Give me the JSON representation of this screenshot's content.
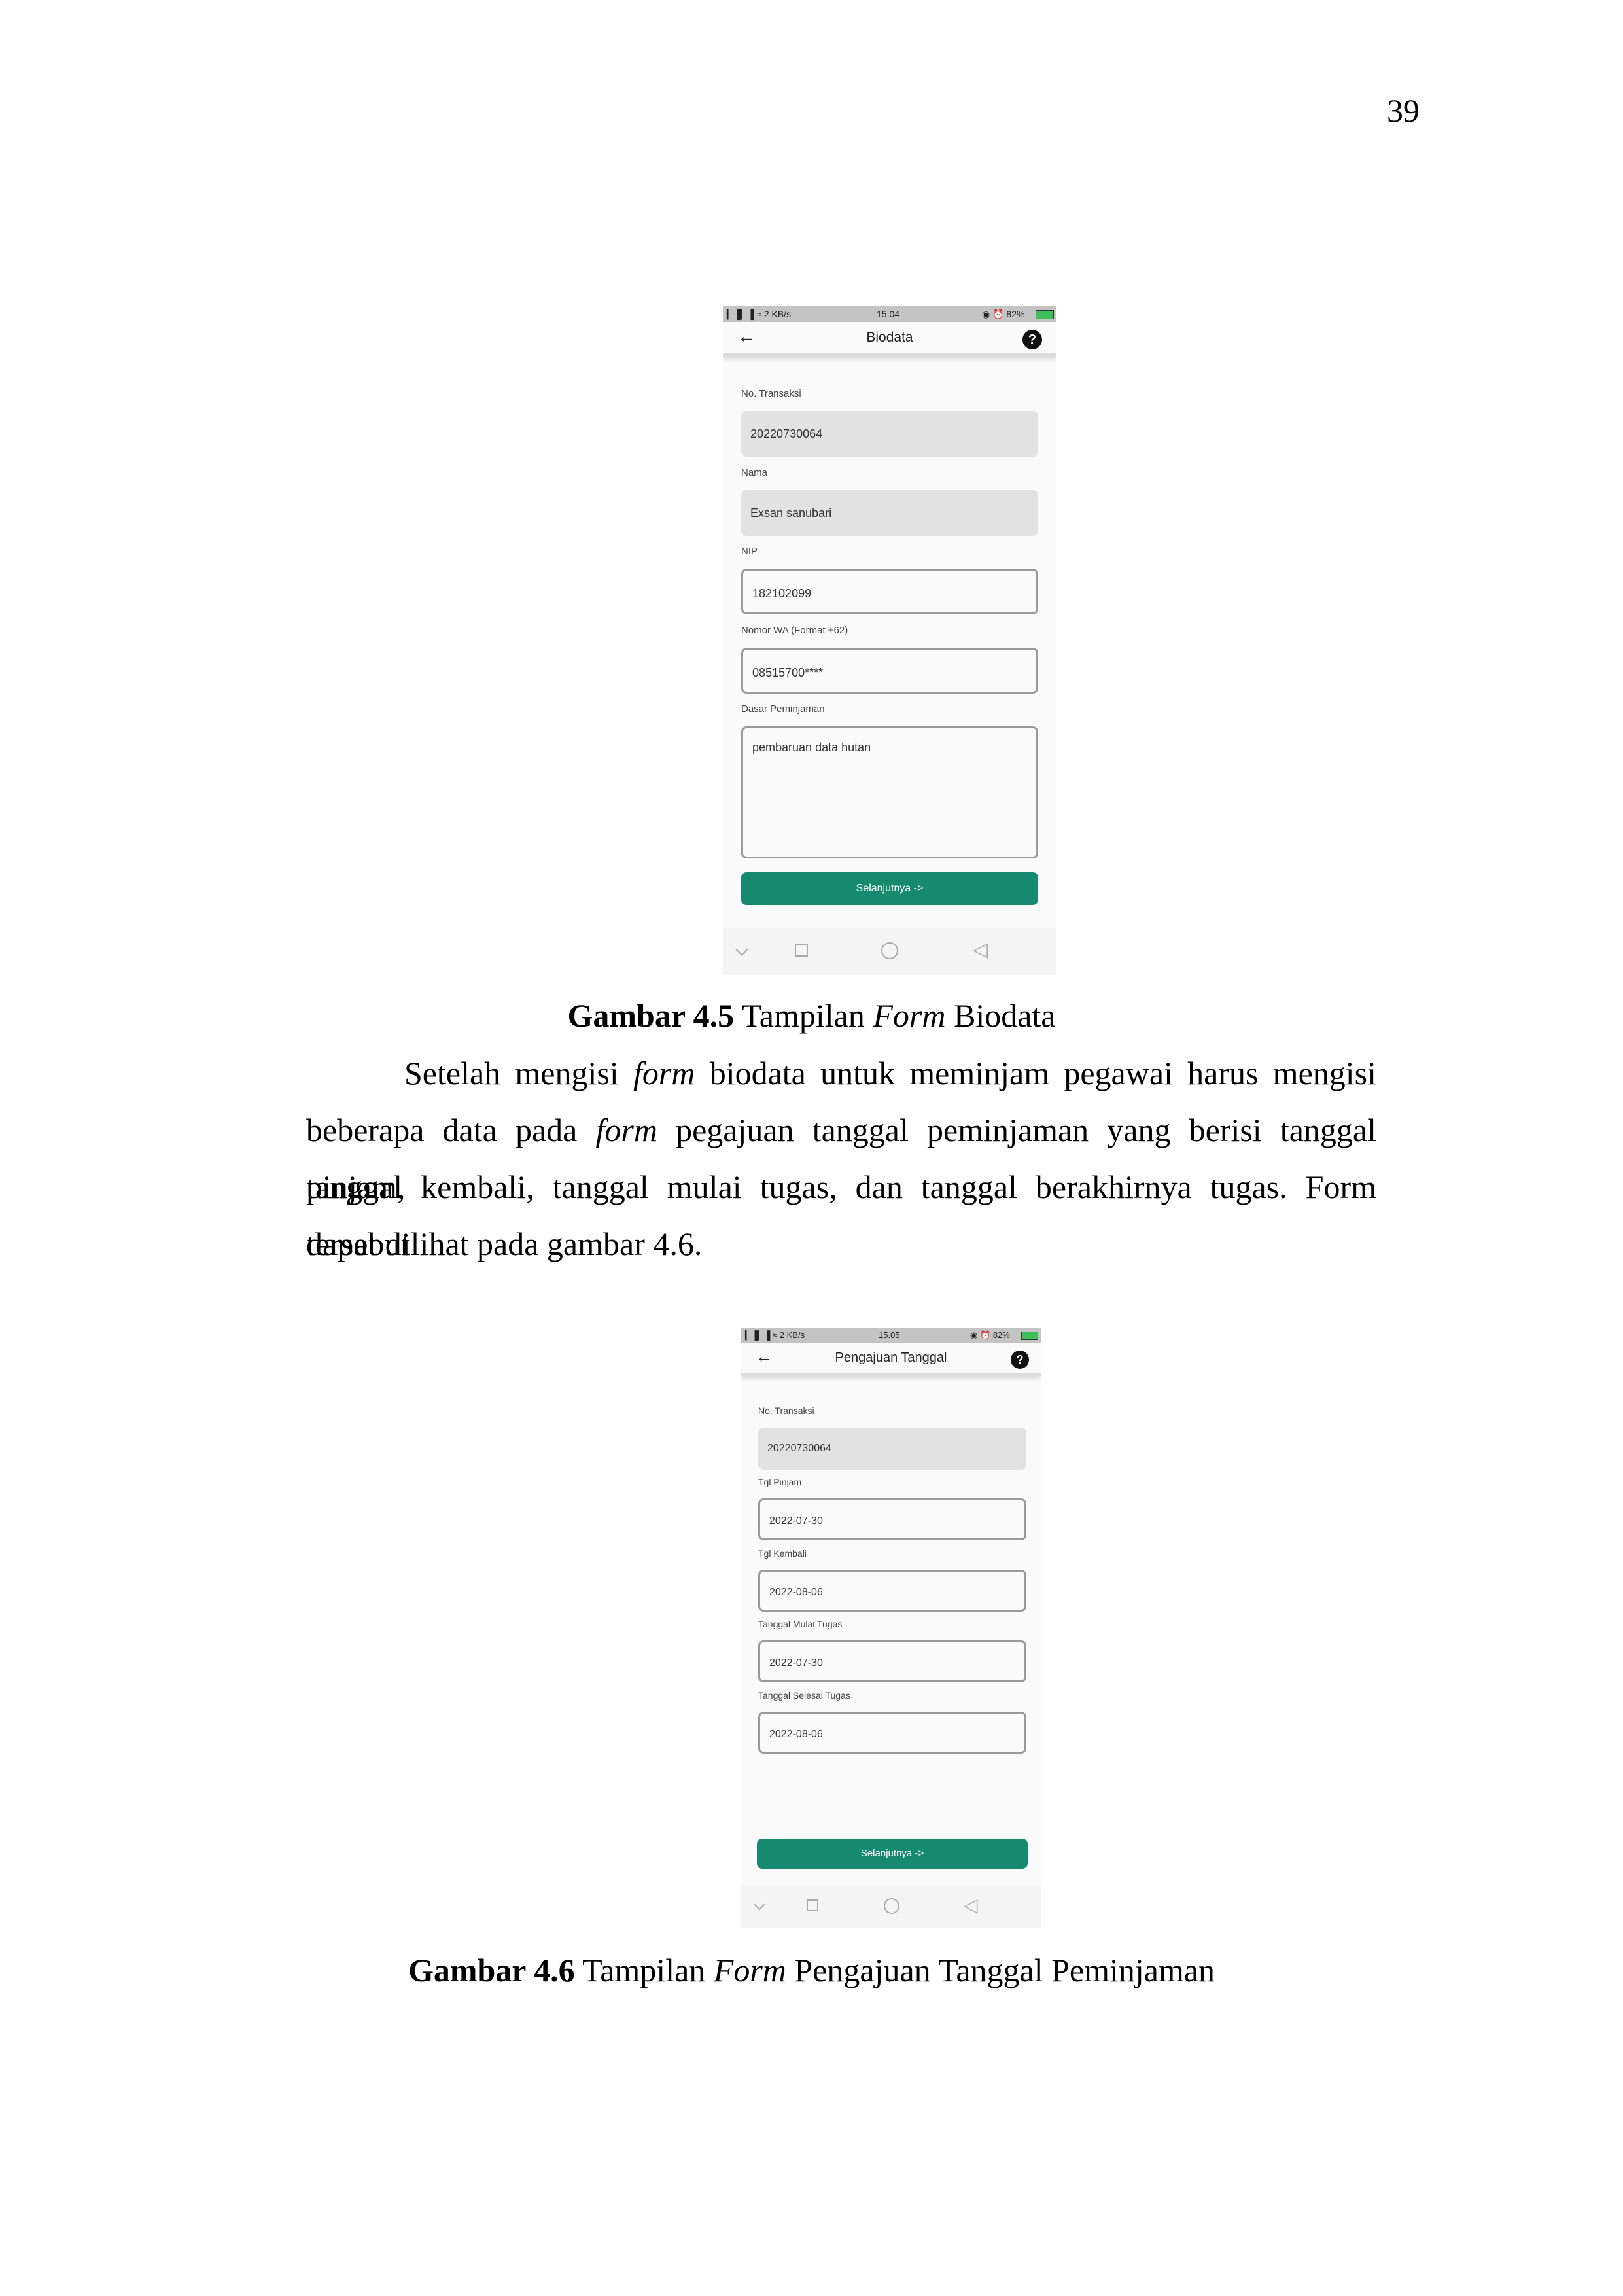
{
  "page_number": "39",
  "figure1": {
    "status": {
      "left": "▎▐▎▐ ≈ 2 KB/s",
      "time": "15.04",
      "right": "◉ ⏰ 82%"
    },
    "title": "Biodata",
    "fields": [
      {
        "label": "No. Transaksi",
        "value": "20220730064"
      },
      {
        "label": "Nama",
        "value": "Exsan sanubari"
      },
      {
        "label": "NIP",
        "value": "182102099"
      },
      {
        "label": "Nomor WA (Format +62)",
        "value": "08515700****"
      },
      {
        "label": "Dasar Peminjaman",
        "value": "pembaruan data hutan"
      }
    ],
    "button": "Selanjutnya ->",
    "caption_bold": "Gambar 4.5",
    "caption_pre": " Tampilan ",
    "caption_italic": "Form",
    "caption_post": " Biodata"
  },
  "paragraph": {
    "line1_a": "Setelah mengisi",
    "line1_italic": "form",
    "line1_b": "biodata untuk meminjam pegawai harus mengisi",
    "line2_a": "beberapa data pada",
    "line2_italic": "form",
    "line2_b": "pegajuan tanggal peminjaman yang berisi tanggal pinjam,",
    "line3": "tanggal kembali, tanggal mulai tugas, dan tanggal berakhirnya tugas. Form tersebut",
    "line4": "dapat dilihat pada gambar 4.6."
  },
  "figure2": {
    "status": {
      "left": "▎▐▎▐ ≈ 2 KB/s",
      "time": "15.05",
      "right": "◉ ⏰ 82%"
    },
    "title": "Pengajuan Tanggal",
    "fields": [
      {
        "label": "No. Transaksi",
        "value": "20220730064"
      },
      {
        "label": "Tgl Pinjam",
        "value": "2022-07-30"
      },
      {
        "label": "Tgl Kembali",
        "value": "2022-08-06"
      },
      {
        "label": "Tanggal Mulai Tugas",
        "value": "2022-07-30"
      },
      {
        "label": "Tanggal Selesai Tugas",
        "value": "2022-08-06"
      }
    ],
    "button": "Selanjutnya ->",
    "caption_bold": "Gambar 4.6",
    "caption_pre": " Tampilan ",
    "caption_italic": "Form",
    "caption_post": " Pengajuan Tanggal Peminjaman"
  },
  "colors": {
    "accent": "#168a70",
    "status_bar": "#c4c4c4",
    "readonly_field": "#e2e2e2",
    "battery": "#3cc05a"
  },
  "icons": [
    "back-arrow-icon",
    "help-icon",
    "nav-down-icon",
    "nav-square-icon",
    "nav-circle-icon",
    "nav-triangle-icon",
    "battery-icon"
  ]
}
